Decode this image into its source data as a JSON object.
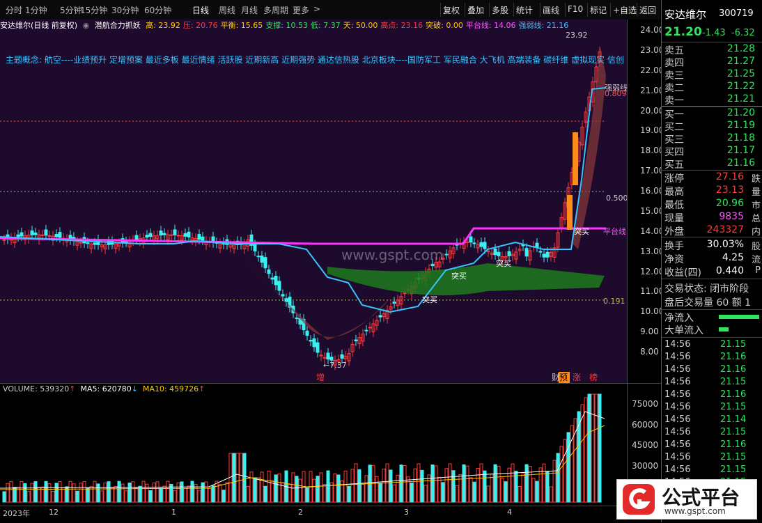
{
  "topbar": {
    "periods": [
      "分时",
      "1分钟",
      "5分钟",
      "15分钟",
      "30分钟",
      "60分钟",
      "日线",
      "周线",
      "月线",
      "多周期",
      "更多"
    ],
    "active": "日线",
    "more_arrow": ">",
    "right_buttons": [
      "复权",
      "叠加",
      "多股",
      "统计",
      "画线",
      "F10",
      "标记",
      "+自选",
      "返回"
    ]
  },
  "chart": {
    "stock_title": "安达维尔(日线 前复权)",
    "indicator_name": "潜航合力抓妖",
    "fields": [
      {
        "label": "高:",
        "value": "23.92",
        "color": "#ffcc00"
      },
      {
        "label": "压:",
        "value": "20.76",
        "color": "#ff3b3b"
      },
      {
        "label": "平衡:",
        "value": "15.65",
        "color": "#ffcc00"
      },
      {
        "label": "支撑:",
        "value": "10.53",
        "color": "#2ee55c"
      },
      {
        "label": "低:",
        "value": "7.37",
        "color": "#2ee55c"
      },
      {
        "label": "天:",
        "value": "50.00",
        "color": "#ffcc00"
      },
      {
        "label": "高点:",
        "value": "23.16",
        "color": "#ff3b3b"
      },
      {
        "label": "突破:",
        "value": "0.00",
        "color": "#ffcc00"
      },
      {
        "label": "平台线:",
        "value": "14.06",
        "color": "#ff55ff"
      },
      {
        "label": "强弱线:",
        "value": "21.16",
        "color": "#39c3ff"
      }
    ],
    "concepts": "主题概念: 航空----业绩预升 定增预案 最近多板 最近情绪 活跃股 近期新高 近期强势 通达信热股 北京板块----国防军工 军民融合 大飞机 高端装备 碳纤维 虚拟现实 信创 低空",
    "watermark_text": "www.gspt.com",
    "annotations": {
      "high": "23.92",
      "low": "7.37",
      "strong_weak": "强弱线",
      "platform": "平台线",
      "breakout_buy": "突买",
      "fib_0809": "0.809",
      "fib_0500": "0.500",
      "fib_0191": "0.191",
      "zeng": "增",
      "cai": "财",
      "yu": "预",
      "zhang": "涨",
      "bang": "榜"
    },
    "yticks": [
      "24.00",
      "23.00",
      "22.00",
      "21.00",
      "20.00",
      "19.00",
      "18.00",
      "17.00",
      "16.00",
      "15.00",
      "14.00",
      "13.00",
      "12.00",
      "11.00",
      "10.00",
      "9.00",
      "8.00"
    ],
    "colors": {
      "up": "#ff3b3b",
      "down": "#39f0f0",
      "platform": "#ff33ff",
      "strong": "#39c3ff",
      "bg": "#1d0a2c"
    }
  },
  "volume": {
    "label": "VOLUME:",
    "value": "539320",
    "ma5_label": "MA5:",
    "ma5": "620780",
    "ma10_label": "MA10:",
    "ma10": "459726",
    "yticks": [
      "75000",
      "60000",
      "45000",
      "30000",
      "15000"
    ]
  },
  "dates": [
    "2023年",
    "12",
    "1",
    "2",
    "3",
    "4"
  ],
  "quote": {
    "name": "安达维尔",
    "code": "300719",
    "price": "21.20",
    "change": "-1.43",
    "pct": "-6.32",
    "asks": [
      {
        "label": "卖五",
        "price": "21.28"
      },
      {
        "label": "卖四",
        "price": "21.27"
      },
      {
        "label": "卖三",
        "price": "21.25"
      },
      {
        "label": "卖二",
        "price": "21.22"
      },
      {
        "label": "卖一",
        "price": "21.21"
      }
    ],
    "bids": [
      {
        "label": "买一",
        "price": "21.20"
      },
      {
        "label": "买二",
        "price": "21.19"
      },
      {
        "label": "买三",
        "price": "21.18"
      },
      {
        "label": "买四",
        "price": "21.17"
      },
      {
        "label": "买五",
        "price": "21.16"
      }
    ],
    "stats": [
      {
        "label": "涨停",
        "value": "27.16",
        "color": "#ff3b3b",
        "tail": "跌"
      },
      {
        "label": "最高",
        "value": "23.13",
        "color": "#ff3b3b",
        "tail": "量"
      },
      {
        "label": "最低",
        "value": "20.96",
        "color": "#2ee55c",
        "tail": "市"
      },
      {
        "label": "现量",
        "value": "9835",
        "color": "#ff55ff",
        "tail": "总"
      },
      {
        "label": "外盘",
        "value": "243327",
        "color": "#ff3b3b",
        "tail": "内"
      }
    ],
    "stats2": [
      {
        "label": "换手",
        "value": "30.03%",
        "tail": "股"
      },
      {
        "label": "净资",
        "value": "4.25",
        "tail": "流"
      },
      {
        "label": "收益(四)",
        "value": "0.440",
        "tail": "P"
      }
    ],
    "trade_status": "交易状态: 闭市阶段",
    "after_hours": "盘后交易量 60 额 1",
    "net_inflow": "净流入",
    "big_inflow": "大单流入",
    "ticks": [
      {
        "time": "14:56",
        "price": "21.15"
      },
      {
        "time": "14:56",
        "price": "21.16"
      },
      {
        "time": "14:56",
        "price": "21.16"
      },
      {
        "time": "14:56",
        "price": "21.15"
      },
      {
        "time": "14:56",
        "price": "21.16"
      },
      {
        "time": "14:56",
        "price": "21.15"
      },
      {
        "time": "14:56",
        "price": "21.14"
      },
      {
        "time": "14:56",
        "price": "21.15"
      },
      {
        "time": "14:56",
        "price": "21.16"
      },
      {
        "time": "14:56",
        "price": "21.15"
      },
      {
        "time": "14:56",
        "price": "21.15"
      },
      {
        "time": "14:56",
        "price": "21.15"
      }
    ]
  },
  "logo": {
    "text": "公式平台",
    "url_text": "www.gspt.com"
  }
}
